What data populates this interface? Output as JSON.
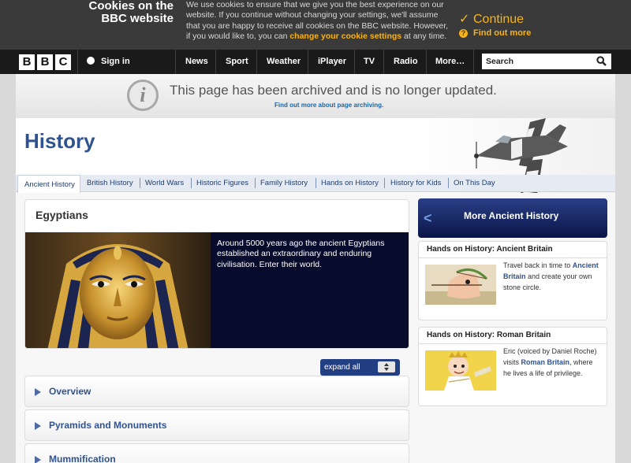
{
  "cookie": {
    "title_line1": "Cookies on the",
    "title_line2": "BBC website",
    "text_part1": "We use cookies to ensure that we give you the best experience on our website. If you continue without changing your settings, we'll assume that you are happy to receive all cookies on the BBC website. However, if you would like to, you can ",
    "settings_link": "change your cookie settings",
    "text_part2": " at any time.",
    "continue_label": "Continue",
    "find_out_label": "Find out more",
    "accent_color": "#f8b316"
  },
  "nav": {
    "logo_letters": [
      "B",
      "B",
      "C"
    ],
    "sign_in": "Sign in",
    "items": [
      "News",
      "Sport",
      "Weather",
      "iPlayer",
      "TV",
      "Radio",
      "More…"
    ],
    "search_placeholder": "Search"
  },
  "archive": {
    "icon_letter": "i",
    "message": "This page has been archived and is no longer updated.",
    "link": "Find out more about page archiving."
  },
  "header": {
    "title": "History",
    "title_color": "#2f5390"
  },
  "tabs": [
    {
      "label": "Ancient History",
      "active": true
    },
    {
      "label": "British History",
      "active": false
    },
    {
      "label": "World Wars",
      "active": false
    },
    {
      "label": "Historic Figures",
      "active": false
    },
    {
      "label": "Family History",
      "active": false
    },
    {
      "label": "Hands on History",
      "active": false
    },
    {
      "label": "History for Kids",
      "active": false
    },
    {
      "label": "On This Day",
      "active": false
    }
  ],
  "feature": {
    "title": "Egyptians",
    "description": "Around 5000 years ago the ancient Egyptians established an extraordinary and enduring civilisation. Enter their world."
  },
  "expand": {
    "label": "expand all"
  },
  "accordion": [
    {
      "label": "Overview"
    },
    {
      "label": "Pyramids and Monuments"
    },
    {
      "label": "Mummification"
    }
  ],
  "sidebar": {
    "header": "More Ancient History",
    "cards": [
      {
        "title": "Hands on History: Ancient Britain",
        "text_before": "Travel back in time to ",
        "link": "Ancient Britain",
        "text_after": " and create your own stone circle."
      },
      {
        "title": "Hands on History: Roman Britain",
        "text_before": "Eric (voiced by Daniel Roche) visits ",
        "link": "Roman Britain",
        "text_after": ", where he lives a life of privilege."
      }
    ]
  }
}
